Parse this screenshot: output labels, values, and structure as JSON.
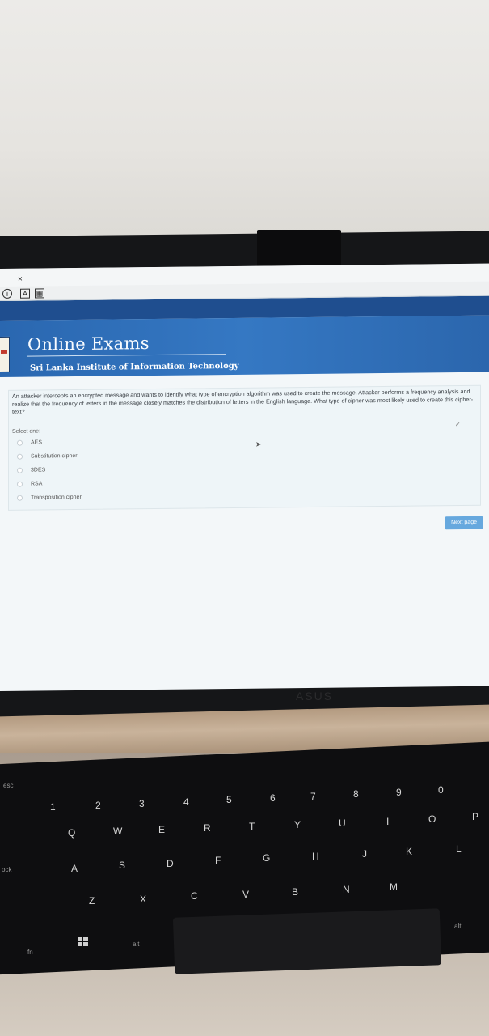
{
  "browser": {
    "close_glyph": "×"
  },
  "header": {
    "site_title": "Online Exams",
    "institution": "Sri Lanka Institute of Information Technology"
  },
  "question": {
    "text": "An attacker intercepts an encrypted message and wants to identify what type of encryption algorithm was used to create the message. Attacker performs a frequency analysis and realize that the frequency of letters in the message closely matches the distribution of letters in the English language. What type of cipher was most likely used to create this cipher-text?",
    "prompt": "Select one:",
    "options": [
      {
        "label": "AES"
      },
      {
        "label": "Substitution cipher"
      },
      {
        "label": "3DES"
      },
      {
        "label": "RSA"
      },
      {
        "label": "Transposition cipher"
      }
    ]
  },
  "actions": {
    "next_label": "Next page"
  },
  "laptop": {
    "brand": "ASUS",
    "keys": {
      "esc": "esc",
      "fn": "fn",
      "alt_left": "alt",
      "alt_right": "alt",
      "caps": "ock",
      "num_row": [
        "1",
        "2",
        "3",
        "4",
        "5",
        "6",
        "7",
        "8",
        "9",
        "0"
      ],
      "row_q": [
        "Q",
        "W",
        "E",
        "R",
        "T",
        "Y",
        "U",
        "I",
        "O",
        "P"
      ],
      "row_a": [
        "A",
        "S",
        "D",
        "F",
        "G",
        "H",
        "J",
        "K",
        "L"
      ],
      "row_z": [
        "Z",
        "X",
        "C",
        "V",
        "B",
        "N",
        "M"
      ]
    }
  }
}
